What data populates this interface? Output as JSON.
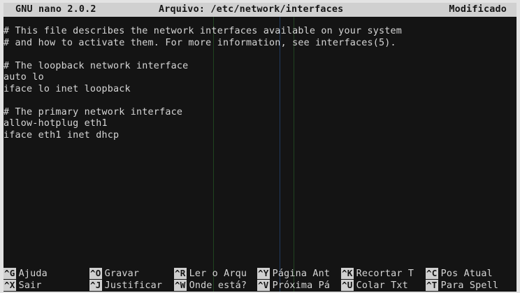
{
  "titlebar": {
    "program": "GNU nano 2.0.2",
    "file": "Arquivo: /etc/network/interfaces",
    "status": "Modificado"
  },
  "editor": {
    "lines": [
      "# This file describes the network interfaces available on your system",
      "# and how to activate them. For more information, see interfaces(5).",
      "",
      "# The loopback network interface",
      "auto lo",
      "iface lo inet loopback",
      "",
      "# The primary network interface",
      "allow-hotplug eth1",
      "iface eth1 inet dhcp"
    ]
  },
  "shortcuts": {
    "row1": [
      {
        "key": "^G",
        "label": "Ajuda"
      },
      {
        "key": "^O",
        "label": "Gravar"
      },
      {
        "key": "^R",
        "label": "Ler o Arqu"
      },
      {
        "key": "^Y",
        "label": "Página Ant"
      },
      {
        "key": "^K",
        "label": "Recortar T"
      },
      {
        "key": "^C",
        "label": "Pos Atual"
      }
    ],
    "row2": [
      {
        "key": "^X",
        "label": "Sair"
      },
      {
        "key": "^J",
        "label": "Justificar"
      },
      {
        "key": "^W",
        "label": "Onde está?"
      },
      {
        "key": "^V",
        "label": "Próxima Pá"
      },
      {
        "key": "^U",
        "label": "Colar Txt"
      },
      {
        "key": "^T",
        "label": "Para Spell"
      }
    ]
  }
}
